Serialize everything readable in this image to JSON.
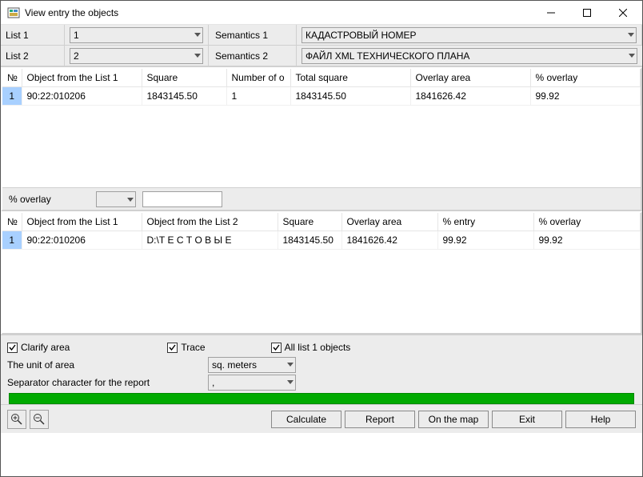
{
  "window": {
    "title": "View entry the objects"
  },
  "top": {
    "list1_label": "List 1",
    "list2_label": "List 2",
    "list1_value": "1",
    "list2_value": "2",
    "sem1_label": "Semantics 1",
    "sem2_label": "Semantics 2",
    "sem1_value": "КАДАСТРОВЫЙ НОМЕР",
    "sem2_value": "ФАЙЛ XML ТЕХНИЧЕСКОГО ПЛАНА"
  },
  "table1": {
    "headers": [
      "№",
      "Object from the List 1",
      "Square",
      "Number of o",
      "Total square",
      "Overlay area",
      "% overlay"
    ],
    "rows": [
      {
        "num": "1",
        "obj": "90:22:010206",
        "square": "1843145.50",
        "count": "1",
        "total": "1843145.50",
        "overlay": "1841626.42",
        "pct": "99.92"
      }
    ]
  },
  "filter": {
    "label": "% overlay"
  },
  "table2": {
    "headers": [
      "№",
      "Object from the List 1",
      "Object from the List 2",
      "Square",
      "Overlay area",
      "% entry",
      "% overlay"
    ],
    "rows": [
      {
        "num": "1",
        "obj1": "90:22:010206",
        "obj2": "D:\\Т Е С Т О В Ы Е",
        "square": "1843145.50",
        "overlay": "1841626.42",
        "entry": "99.92",
        "pct": "99.92"
      }
    ]
  },
  "options": {
    "clarify": "Clarify area",
    "trace": "Trace",
    "all_list1": "All list 1 objects",
    "unit_label": "The unit of area",
    "unit_value": "sq. meters",
    "sep_label": "Separator character for the report",
    "sep_value": ","
  },
  "footer": {
    "calculate": "Calculate",
    "report": "Report",
    "on_map": "On the map",
    "exit": "Exit",
    "help": "Help"
  }
}
